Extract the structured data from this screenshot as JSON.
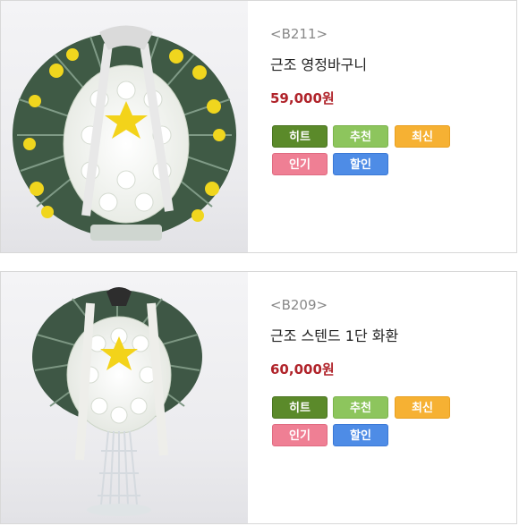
{
  "products": [
    {
      "code": "<B211>",
      "name": "근조 영정바구니",
      "price": "59,000원",
      "image": "funeral-flower-basket",
      "badges": {
        "hit": "히트",
        "recommend": "추천",
        "new": "최신",
        "popular": "인기",
        "discount": "할인"
      }
    },
    {
      "code": "<B209>",
      "name": "근조 스텐드 1단 화환",
      "price": "60,000원",
      "image": "funeral-wreath-stand",
      "badges": {
        "hit": "히트",
        "recommend": "추천",
        "new": "최신",
        "popular": "인기",
        "discount": "할인"
      }
    }
  ],
  "colors": {
    "price": "#b0232a",
    "hit": "#5b8a2a",
    "recommend": "#8dc55d",
    "new": "#f6b133",
    "popular": "#ef7f94",
    "discount": "#4e8ce6"
  }
}
